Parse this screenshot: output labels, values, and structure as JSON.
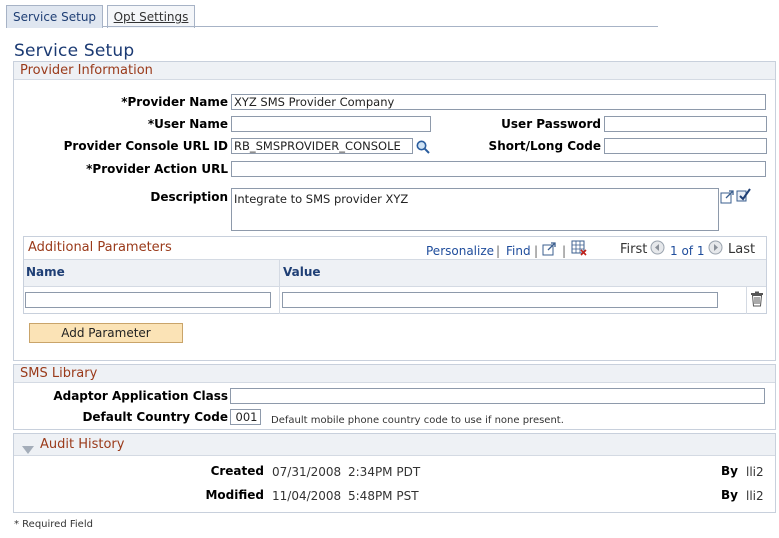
{
  "tabs": [
    {
      "label": "Service Setup",
      "active": true
    },
    {
      "label": "Opt Settings",
      "active": false
    }
  ],
  "page_title": "Service Setup",
  "provider_info": {
    "header": "Provider Information",
    "provider_name_label": "*Provider Name",
    "provider_name_value": "XYZ SMS Provider Company",
    "user_name_label": "*User Name",
    "user_name_value": "",
    "user_password_label": "User Password",
    "console_url_label": "Provider Console URL ID",
    "console_url_value": "RB_SMSPROVIDER_CONSOLE",
    "short_long_label": "Short/Long Code",
    "action_url_label": "*Provider Action URL",
    "action_url_value": "",
    "description_label": "Description",
    "description_value": "Integrate to SMS provider XYZ"
  },
  "additional_params": {
    "title": "Additional Parameters",
    "personalize": "Personalize",
    "find": "Find",
    "nav_sep": "|",
    "first": "First",
    "range": "1 of 1",
    "last": "Last",
    "col_name": "Name",
    "col_value": "Value",
    "add_button": "Add Parameter"
  },
  "sms_library": {
    "header": "SMS Library",
    "adaptor_label": "Adaptor Application Class",
    "adaptor_value": "",
    "country_label": "Default Country Code",
    "country_value": "001",
    "country_hint": "Default mobile phone country code to use if none present."
  },
  "audit": {
    "header": "Audit History",
    "created_label": "Created",
    "created_date": "07/31/2008",
    "created_time": "2:34PM PDT",
    "created_by_label": "By",
    "created_by": "lli2",
    "modified_label": "Modified",
    "modified_date": "11/04/2008",
    "modified_time": "5:48PM PST",
    "modified_by_label": "By",
    "modified_by": "lli2"
  },
  "footer_note": "* Required Field",
  "colors": {
    "header_text": "#9a3a1a",
    "link": "#1f4d9c",
    "title": "#1b3a73",
    "button": "#fbe3b6"
  }
}
